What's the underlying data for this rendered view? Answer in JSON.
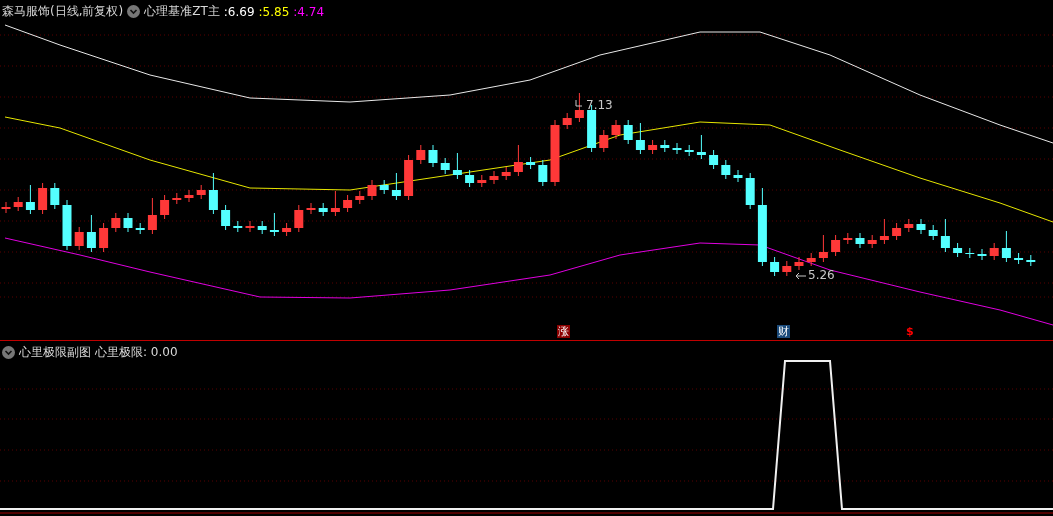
{
  "main_panel": {
    "title": "森马服饰(日线,前复权)",
    "indicator": {
      "name": "心理基准ZT主",
      "values": [
        {
          "text": ":6.69",
          "color": "#ffffff"
        },
        {
          "text": ":5.85",
          "color": "#ffff00"
        },
        {
          "text": ":4.74",
          "color": "#ff00ff"
        }
      ]
    },
    "high_label": "7.13",
    "low_label": "5.26",
    "event_markers": [
      {
        "text": "涨",
        "kind": "boxed",
        "color": "#8b0000"
      },
      {
        "text": "财",
        "kind": "boxed",
        "color": "#1a4a7a"
      },
      {
        "text": "$",
        "kind": "plain",
        "color": "#ff0000"
      }
    ]
  },
  "sub_panel": {
    "title": "心里极限副图",
    "reading": "心里极限: 0.00"
  }
}
